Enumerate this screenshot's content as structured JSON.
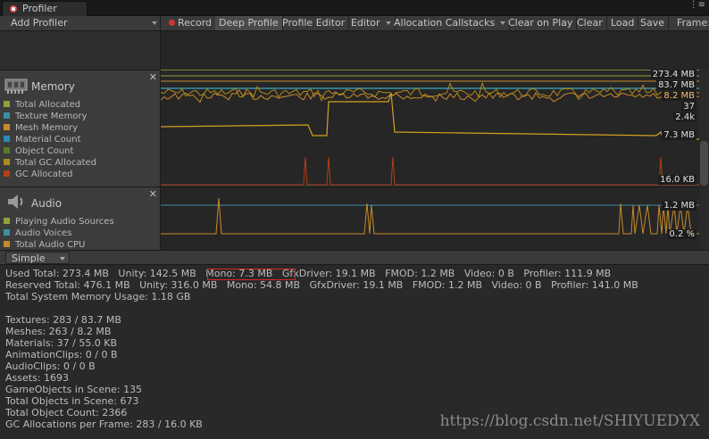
{
  "tab": {
    "title": "Profiler",
    "menu_glyph": "⋮≡"
  },
  "toolbar": {
    "add_profiler": "Add Profiler",
    "record": "Record",
    "deep_profile": "Deep Profile",
    "profile_editor": "Profile Editor",
    "editor": "Editor",
    "allocation_callstacks": "Allocation Callstacks",
    "clear_on_play": "Clear on Play",
    "clear": "Clear",
    "load": "Load",
    "save": "Save",
    "frame": "Frame:"
  },
  "memory_module": {
    "title": "Memory",
    "legend": [
      {
        "label": "Total Allocated",
        "color": "#8fa33a"
      },
      {
        "label": "Texture Memory",
        "color": "#3a8fa3"
      },
      {
        "label": "Mesh Memory",
        "color": "#c78a2a"
      },
      {
        "label": "Material Count",
        "color": "#2a8ab8"
      },
      {
        "label": "Object Count",
        "color": "#5a7a2a"
      },
      {
        "label": "Total GC Allocated",
        "color": "#b08a1a"
      },
      {
        "label": "GC Allocated",
        "color": "#b0401a"
      }
    ],
    "value_labels": [
      "273.4 MB",
      "83.7 MB",
      "8.2 MB",
      "37",
      "2.4k",
      "7.3 MB",
      "16.0 KB"
    ]
  },
  "audio_module": {
    "title": "Audio",
    "legend": [
      {
        "label": "Playing Audio Sources",
        "color": "#8fa33a"
      },
      {
        "label": "Audio Voices",
        "color": "#3a8fa3"
      },
      {
        "label": "Total Audio CPU",
        "color": "#c78a2a"
      }
    ],
    "value_labels": [
      "1.2 MB",
      "0.2 %"
    ]
  },
  "detail_view": {
    "mode": "Simple"
  },
  "details": {
    "used_total": "Used Total: 273.4 MB   Unity: 142.5 MB   Mono: 7.3 MB   GfxDriver: 19.1 MB   FMOD: 1.2 MB   Video: 0 B   Profiler: 111.9 MB",
    "reserved_total": "Reserved Total: 476.1 MB   Unity: 316.0 MB   Mono: 54.8 MB   GfxDriver: 19.1 MB   FMOD: 1.2 MB   Video: 0 B   Profiler: 141.0 MB",
    "system_memory": "Total System Memory Usage: 1.18 GB",
    "textures": "Textures: 283 / 83.7 MB",
    "meshes": "Meshes: 263 / 8.2 MB",
    "materials": "Materials: 37 / 55.0 KB",
    "animation_clips": "AnimationClips: 0 / 0 B",
    "audio_clips": "AudioClips: 0 / 0 B",
    "assets": "Assets: 1693",
    "gameobjects_in_scene": "GameObjects in Scene: 135",
    "total_objects_in_scene": "Total Objects in Scene: 673",
    "total_object_count": "Total Object Count: 2366",
    "gc_allocations": "GC Allocations per Frame: 283 / 16.0 KB"
  },
  "watermark": "https://blog.csdn.net/SHIYUEDYX"
}
